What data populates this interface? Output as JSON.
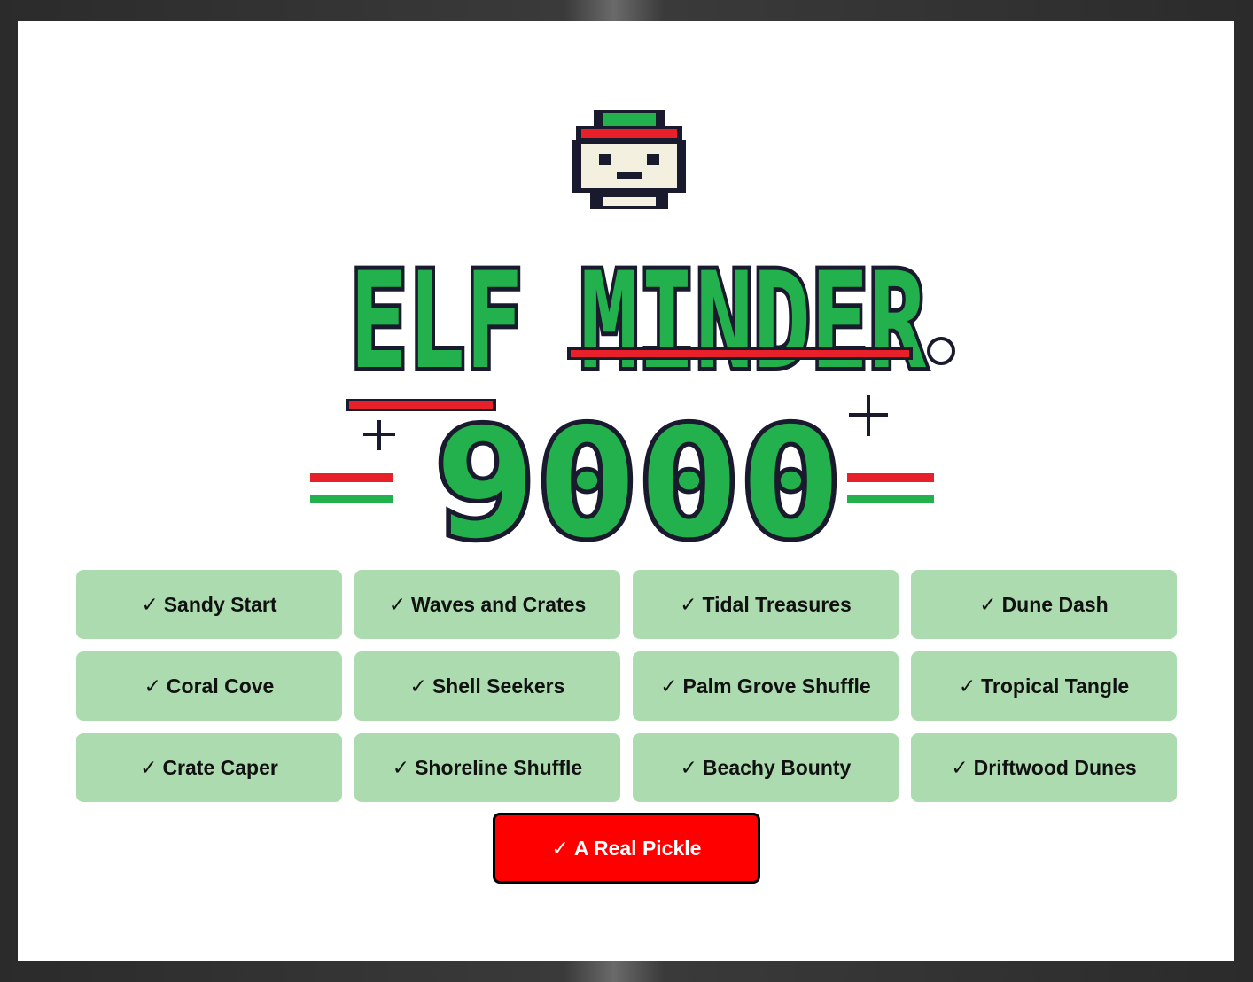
{
  "logo": {
    "title_line1": "ELF MINDER",
    "title_line2": "9000",
    "alt": "ELF MINDER 9000"
  },
  "check_mark": "✓",
  "levels": [
    {
      "label": "Sandy Start"
    },
    {
      "label": "Waves and Crates"
    },
    {
      "label": "Tidal Treasures"
    },
    {
      "label": "Dune Dash"
    },
    {
      "label": "Coral Cove"
    },
    {
      "label": "Shell Seekers"
    },
    {
      "label": "Palm Grove Shuffle"
    },
    {
      "label": "Tropical Tangle"
    },
    {
      "label": "Crate Caper"
    },
    {
      "label": "Shoreline Shuffle"
    },
    {
      "label": "Beachy Bounty"
    },
    {
      "label": "Driftwood Dunes"
    }
  ],
  "special_level": {
    "label": "A Real Pickle"
  },
  "colors": {
    "level_button": "#addbb0",
    "special_button": "#ff0000",
    "logo_green": "#22b14c",
    "logo_red": "#e8202a",
    "logo_cream": "#f4f0e0",
    "logo_outline": "#1a1a2e"
  }
}
